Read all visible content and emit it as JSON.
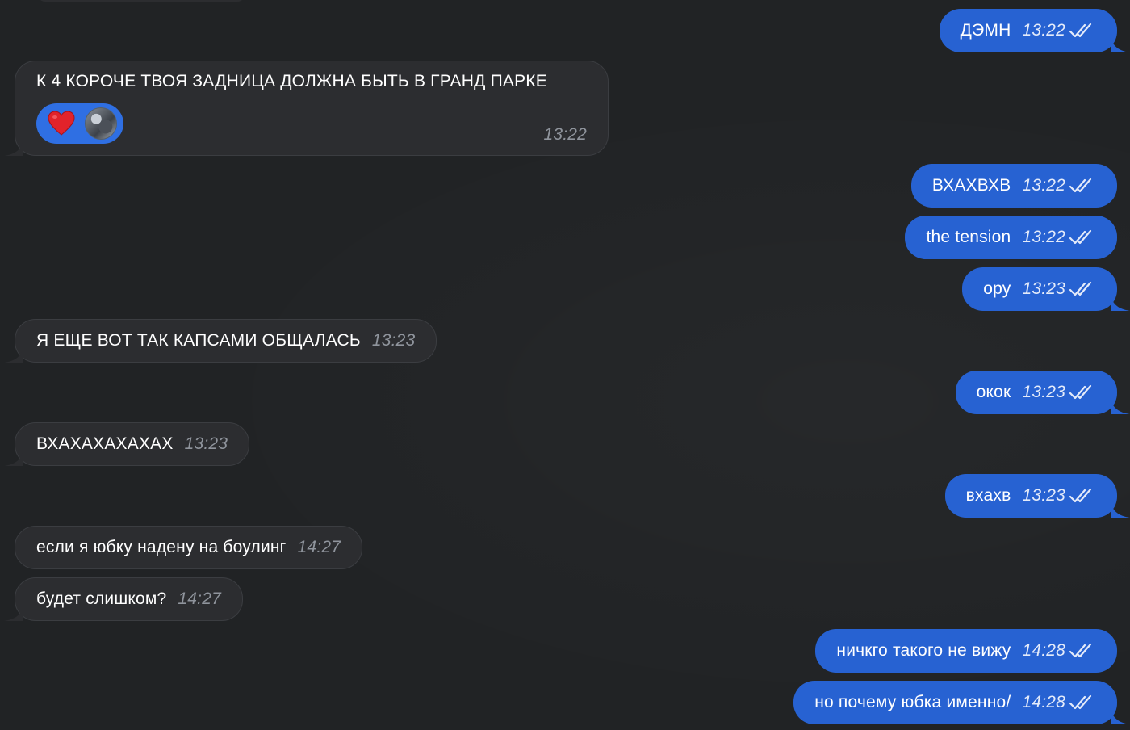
{
  "messages": [
    {
      "id": 0,
      "side": "out",
      "text": "ДЭМН",
      "time": "13:22"
    },
    {
      "id": 1,
      "side": "in",
      "text": "К 4 КОРОЧЕ ТВОЯ ЗАДНИЦА ДОЛЖНА БЫТЬ В ГРАНД ПАРКЕ",
      "time": "13:22",
      "reaction": "heart"
    },
    {
      "id": 2,
      "side": "out",
      "text": "ВХАХВХВ",
      "time": "13:22"
    },
    {
      "id": 3,
      "side": "out",
      "text": "the tension",
      "time": "13:22"
    },
    {
      "id": 4,
      "side": "out",
      "text": "ору",
      "time": "13:23"
    },
    {
      "id": 5,
      "side": "in",
      "text": "Я ЕЩЕ ВОТ ТАК КАПСАМИ ОБЩАЛАСЬ",
      "time": "13:23"
    },
    {
      "id": 6,
      "side": "out",
      "text": "окок",
      "time": "13:23"
    },
    {
      "id": 7,
      "side": "in",
      "text": "ВХАХАХАХАХАХ",
      "time": "13:23"
    },
    {
      "id": 8,
      "side": "out",
      "text": "вхахв",
      "time": "13:23"
    },
    {
      "id": 9,
      "side": "in",
      "text": "если я юбку надену на боулинг",
      "time": "14:27"
    },
    {
      "id": 10,
      "side": "in",
      "text": "будет слишком?",
      "time": "14:27"
    },
    {
      "id": 11,
      "side": "out",
      "text": "ничкго такого не вижу",
      "time": "14:28"
    },
    {
      "id": 12,
      "side": "out",
      "text": "но почему юбка именно/",
      "time": "14:28"
    }
  ],
  "colors": {
    "background": "#212325",
    "incoming_bubble": "#2c2d30",
    "outgoing_bubble": "#2762d2",
    "reaction_pill": "#2f6fe3"
  },
  "icons": {
    "read_status": "double-check-icon",
    "reaction": "heart-icon",
    "reactor": "avatar"
  }
}
